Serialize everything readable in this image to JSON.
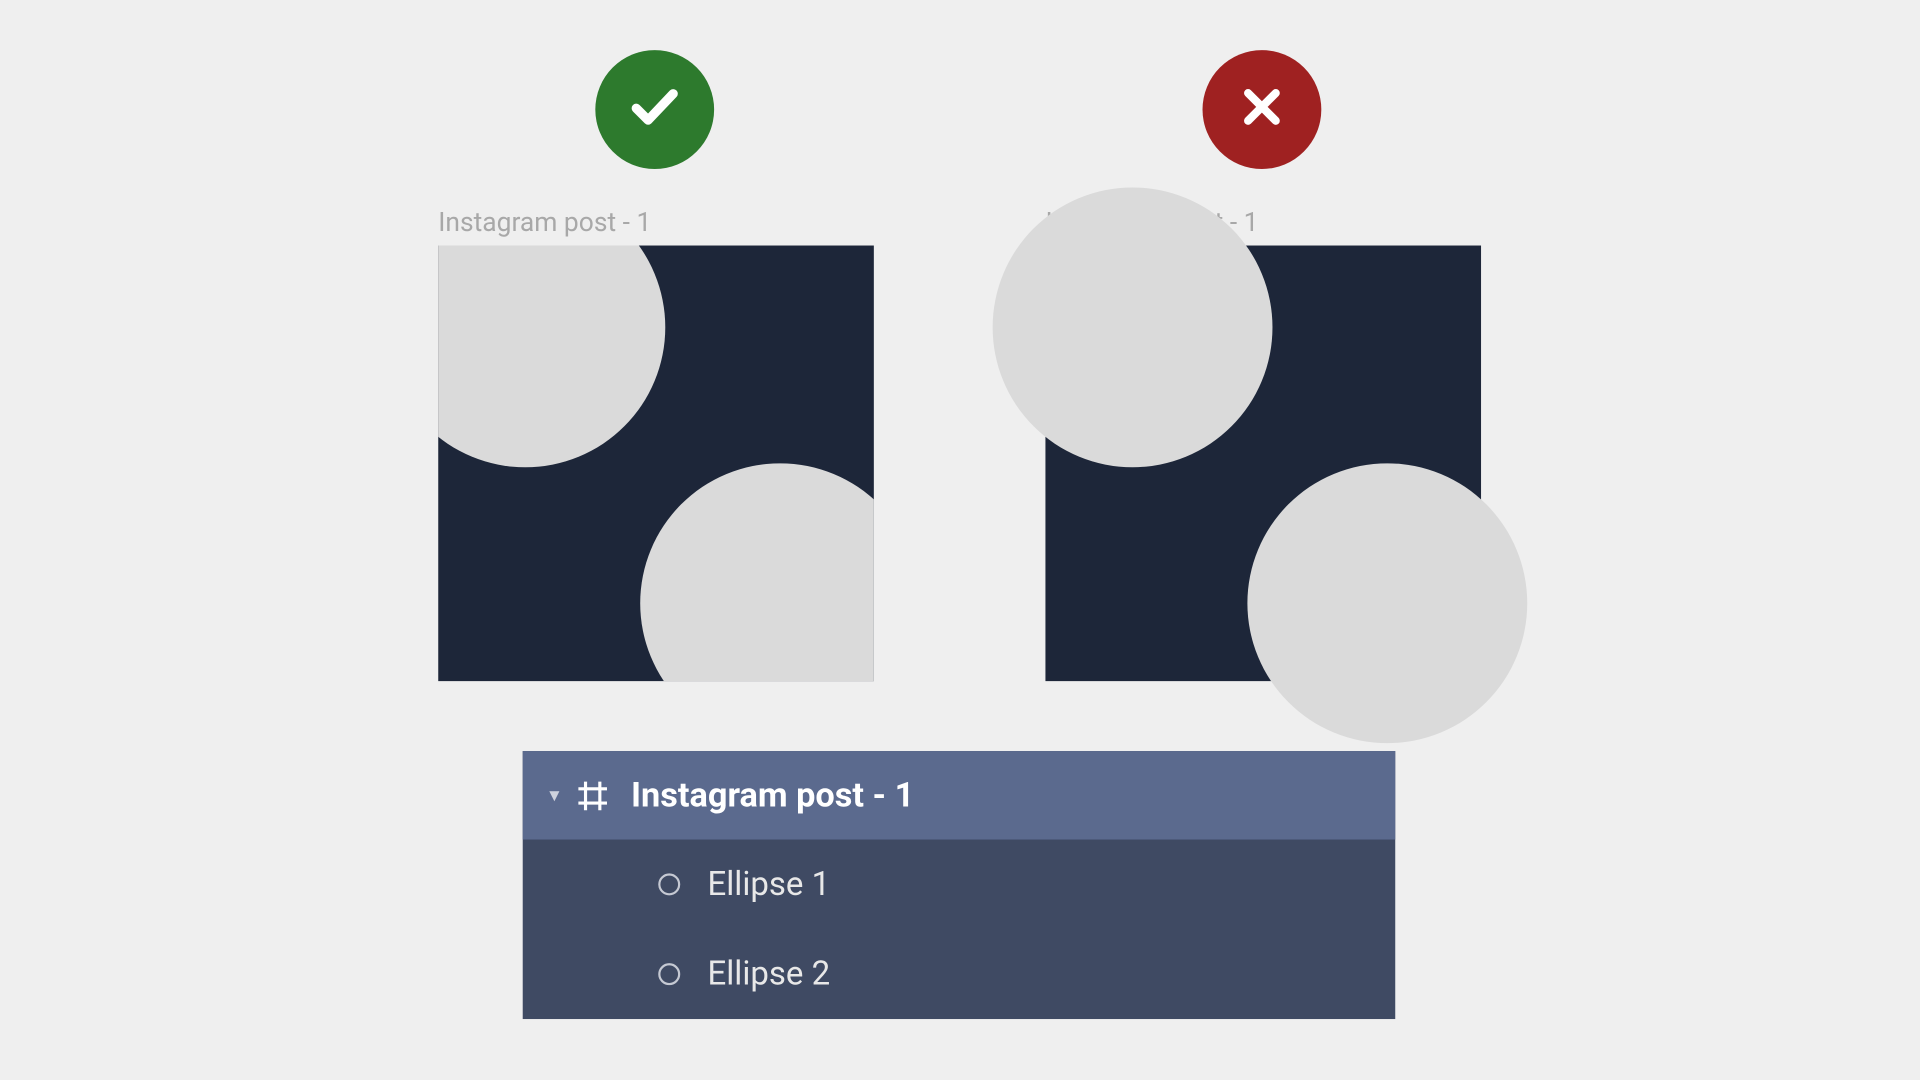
{
  "examples": {
    "left_label": "Instagram post - 1",
    "right_label": "Instagram post - 1"
  },
  "layers": {
    "parent": "Instagram post - 1",
    "child1": "Ellipse 1",
    "child2": "Ellipse 2"
  },
  "icons": {
    "check": "check-icon",
    "cross": "cross-icon",
    "chevron_down": "chevron-down-icon",
    "frame": "frame-icon",
    "ellipse": "ellipse-icon"
  },
  "colors": {
    "bg": "#efefef",
    "frame_bg": "#1d2639",
    "ellipse_fill": "#dadada",
    "panel_bg": "#3f4a63",
    "panel_row_active": "#5b6a8e",
    "correct": "#2d7a2d",
    "wrong": "#9f2121"
  }
}
